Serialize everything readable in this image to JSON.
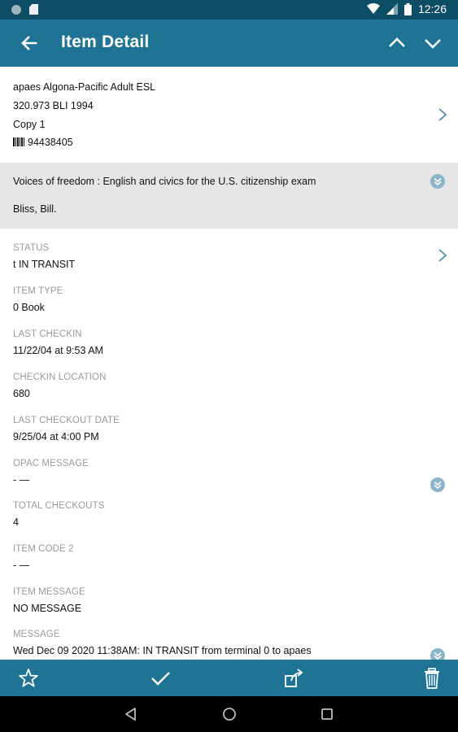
{
  "status_bar": {
    "time": "12:26",
    "icons": [
      "circle-notification-icon",
      "sd-card-icon",
      "wifi-icon",
      "signal-icon",
      "battery-icon"
    ]
  },
  "app_bar": {
    "title": "Item Detail",
    "icons": [
      "back-arrow-icon",
      "chevron-up-icon",
      "chevron-down-icon"
    ]
  },
  "item": {
    "location": "apaes Algona-Pacific Adult ESL",
    "call_number": "320.973 BLI 1994",
    "copy": "Copy 1",
    "barcode": "94438405"
  },
  "bib": {
    "title": "Voices of freedom : English and civics for the U.S. citizenship exam",
    "author": "Bliss, Bill."
  },
  "fields": [
    {
      "label": "STATUS",
      "value": "t IN TRANSIT"
    },
    {
      "label": "ITEM TYPE",
      "value": "0 Book"
    },
    {
      "label": "LAST CHECKIN",
      "value": "11/22/04 at 9:53 AM"
    },
    {
      "label": "CHECKIN LOCATION",
      "value": "680"
    },
    {
      "label": "LAST CHECKOUT DATE",
      "value": "9/25/04 at 4:00 PM"
    },
    {
      "label": "OPAC MESSAGE",
      "value": "- —"
    },
    {
      "label": "TOTAL CHECKOUTS",
      "value": "4"
    },
    {
      "label": "ITEM CODE 2",
      "value": "- —"
    },
    {
      "label": "ITEM MESSAGE",
      "value": "NO MESSAGE"
    },
    {
      "label": "MESSAGE",
      "value": "Wed Dec 09 2020 11:38AM: IN TRANSIT from terminal 0 to apaes"
    }
  ],
  "toolbar": {
    "icons": [
      "star-icon",
      "checkmark-icon",
      "open-external-icon",
      "trash-icon"
    ]
  },
  "system_nav": {
    "icons": [
      "back-triangle-icon",
      "home-circle-icon",
      "recents-square-icon"
    ]
  },
  "colors": {
    "status_bar": "#0d4d66",
    "app_bar": "#1f7394",
    "title_block_bg": "#e6e6e6",
    "accent_circle": "#8ab5c9",
    "label_gray": "#9a9a9a"
  }
}
